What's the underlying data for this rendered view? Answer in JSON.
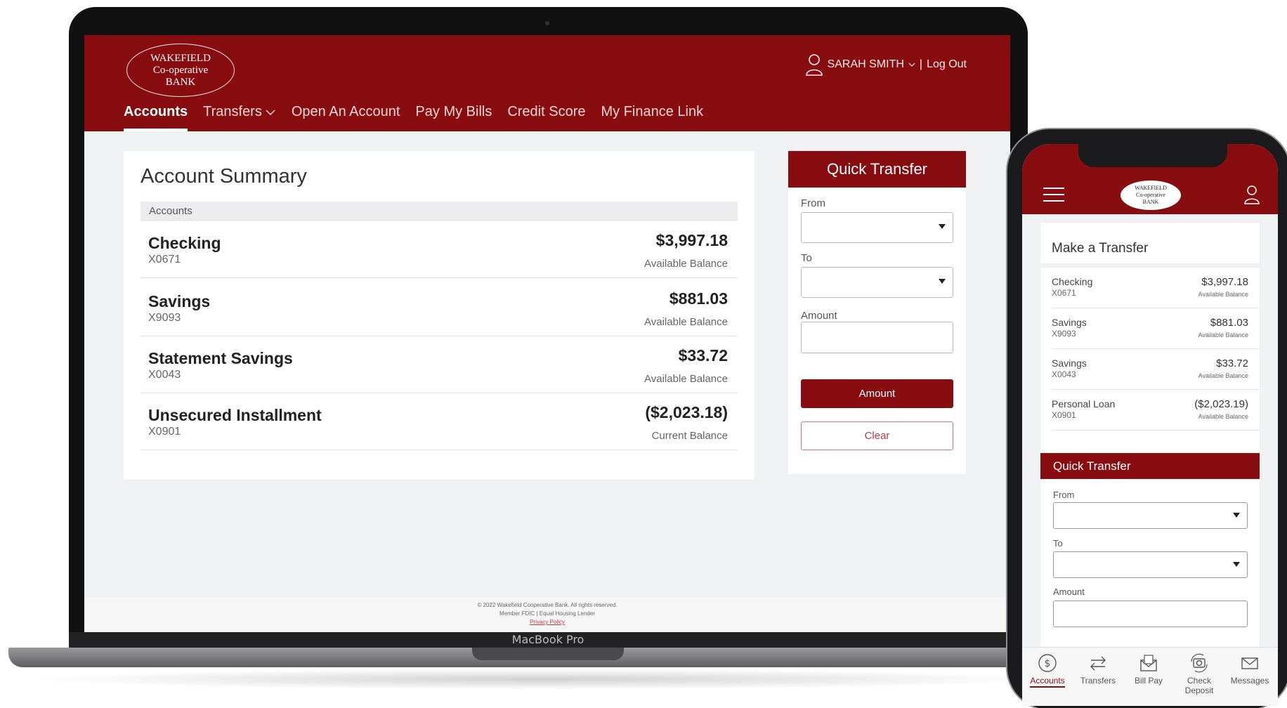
{
  "brand": {
    "logo_lines": [
      "WAKEFIELD",
      "Co-operative",
      "BANK"
    ],
    "primary_color": "#880d10"
  },
  "header": {
    "user_name": "SARAH SMITH",
    "separator": "|",
    "logout_label": "Log Out"
  },
  "nav": {
    "items": [
      {
        "label": "Accounts"
      },
      {
        "label": "Transfers"
      },
      {
        "label": "Open An Account"
      },
      {
        "label": "Pay My Bills"
      },
      {
        "label": "Credit Score"
      },
      {
        "label": "My Finance Link"
      }
    ]
  },
  "summary": {
    "title": "Account Summary",
    "subhead": "Accounts",
    "accounts": [
      {
        "name": "Checking",
        "number": "X0671",
        "amount": "$3,997.18",
        "balance_label": "Available Balance"
      },
      {
        "name": "Savings",
        "number": "X9093",
        "amount": "$881.03",
        "balance_label": "Available Balance"
      },
      {
        "name": "Statement Savings",
        "number": "X0043",
        "amount": "$33.72",
        "balance_label": "Available Balance"
      },
      {
        "name": "Unsecured Installment",
        "number": "X0901",
        "amount": "($2,023.18)",
        "balance_label": "Current Balance"
      }
    ]
  },
  "quick_transfer": {
    "title": "Quick Transfer",
    "from_label": "From",
    "to_label": "To",
    "amount_label": "Amount",
    "submit_label": "Amount",
    "clear_label": "Clear"
  },
  "footer": {
    "copyright": "© 2022 Wakefield Cooperative Bank. All rights reserved.",
    "member": "Member FDIC | Equal Housing Lender",
    "privacy": "Privacy Policy"
  },
  "device": {
    "laptop_label": "MacBook Pro"
  },
  "mobile": {
    "make_transfer_title": "Make a Transfer",
    "accounts": [
      {
        "name": "Checking",
        "number": "X0671",
        "amount": "$3,997.18",
        "balance_label": "Available Balance"
      },
      {
        "name": "Savings",
        "number": "X9093",
        "amount": "$881.03",
        "balance_label": "Available Balance"
      },
      {
        "name": "Savings",
        "number": "X0043",
        "amount": "$33.72",
        "balance_label": "Available Balance"
      },
      {
        "name": "Personal Loan",
        "number": "X0901",
        "amount": "($2,023.19)",
        "balance_label": "Available Balance"
      }
    ],
    "quick_transfer": {
      "title": "Quick Transfer",
      "from_label": "From",
      "to_label": "To",
      "amount_label": "Amount"
    },
    "tabs": [
      {
        "label": "Accounts",
        "icon": "dollar-circle-icon"
      },
      {
        "label": "Transfers",
        "icon": "transfer-arrows-icon"
      },
      {
        "label": "Bill Pay",
        "icon": "bill-envelope-icon"
      },
      {
        "label": "Check Deposit",
        "icon": "camera-deposit-icon"
      },
      {
        "label": "Messages",
        "icon": "mail-icon"
      }
    ]
  }
}
